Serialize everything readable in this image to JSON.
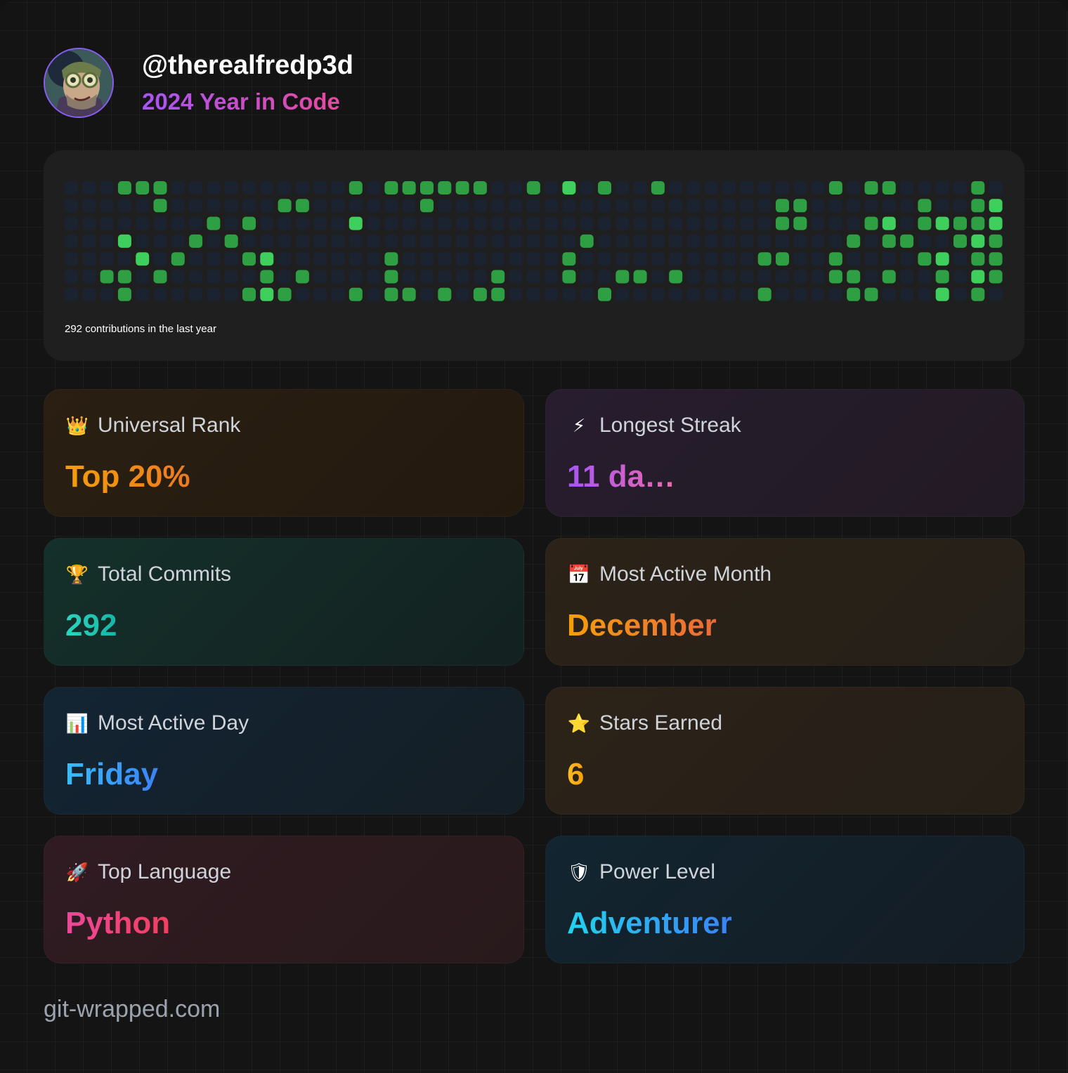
{
  "header": {
    "username": "@therealfredp3d",
    "subtitle": "2024 Year in Code"
  },
  "contributions": {
    "label": "292 contributions in the last year",
    "colors": {
      "empty": "#1b2230",
      "level1": "#2ea043",
      "level2": "#3fcf5c"
    },
    "rows": [
      "0000000000000000000000000000000000000000000000000000000",
      "0000000000000000000000000000000000000000000000000000000",
      "0000000000000000000000000000000000000000000000000000000",
      "0000000000000000000000000000000000000000000000000000000",
      "0000000000000000000000000000000000000000000000000000000",
      "0000000000000000000000000000000000000000000000000000000",
      "0000000000000000000000000000000000000000000000000000000"
    ],
    "active": [
      [
        0,
        3,
        1
      ],
      [
        0,
        4,
        1
      ],
      [
        0,
        5,
        1
      ],
      [
        0,
        16,
        1
      ],
      [
        0,
        18,
        1
      ],
      [
        0,
        19,
        1
      ],
      [
        0,
        20,
        1
      ],
      [
        0,
        21,
        1
      ],
      [
        0,
        22,
        1
      ],
      [
        0,
        23,
        1
      ],
      [
        0,
        26,
        1
      ],
      [
        0,
        28,
        2
      ],
      [
        0,
        30,
        1
      ],
      [
        0,
        33,
        1
      ],
      [
        0,
        43,
        1
      ],
      [
        0,
        45,
        1
      ],
      [
        0,
        46,
        1
      ],
      [
        0,
        51,
        1
      ],
      [
        1,
        5,
        1
      ],
      [
        1,
        12,
        1
      ],
      [
        1,
        13,
        1
      ],
      [
        1,
        20,
        1
      ],
      [
        1,
        40,
        1
      ],
      [
        1,
        41,
        1
      ],
      [
        1,
        48,
        1
      ],
      [
        1,
        51,
        1
      ],
      [
        1,
        52,
        2
      ],
      [
        2,
        8,
        1
      ],
      [
        2,
        10,
        1
      ],
      [
        2,
        16,
        2
      ],
      [
        2,
        40,
        1
      ],
      [
        2,
        41,
        1
      ],
      [
        2,
        45,
        1
      ],
      [
        2,
        46,
        2
      ],
      [
        2,
        48,
        1
      ],
      [
        2,
        49,
        2
      ],
      [
        2,
        50,
        1
      ],
      [
        2,
        51,
        1
      ],
      [
        2,
        52,
        2
      ],
      [
        3,
        3,
        2
      ],
      [
        3,
        7,
        1
      ],
      [
        3,
        9,
        1
      ],
      [
        3,
        29,
        1
      ],
      [
        3,
        44,
        1
      ],
      [
        3,
        46,
        1
      ],
      [
        3,
        47,
        1
      ],
      [
        3,
        50,
        1
      ],
      [
        3,
        51,
        2
      ],
      [
        3,
        52,
        1
      ],
      [
        4,
        4,
        2
      ],
      [
        4,
        6,
        1
      ],
      [
        4,
        10,
        1
      ],
      [
        4,
        11,
        2
      ],
      [
        4,
        18,
        1
      ],
      [
        4,
        28,
        1
      ],
      [
        4,
        39,
        1
      ],
      [
        4,
        40,
        1
      ],
      [
        4,
        43,
        1
      ],
      [
        4,
        48,
        1
      ],
      [
        4,
        49,
        2
      ],
      [
        4,
        51,
        1
      ],
      [
        4,
        52,
        1
      ],
      [
        5,
        2,
        1
      ],
      [
        5,
        3,
        1
      ],
      [
        5,
        5,
        1
      ],
      [
        5,
        11,
        1
      ],
      [
        5,
        13,
        1
      ],
      [
        5,
        18,
        1
      ],
      [
        5,
        24,
        1
      ],
      [
        5,
        28,
        1
      ],
      [
        5,
        31,
        1
      ],
      [
        5,
        32,
        1
      ],
      [
        5,
        34,
        1
      ],
      [
        5,
        43,
        1
      ],
      [
        5,
        44,
        1
      ],
      [
        5,
        46,
        1
      ],
      [
        5,
        49,
        1
      ],
      [
        5,
        51,
        2
      ],
      [
        5,
        52,
        1
      ],
      [
        6,
        3,
        1
      ],
      [
        6,
        10,
        1
      ],
      [
        6,
        11,
        2
      ],
      [
        6,
        12,
        1
      ],
      [
        6,
        16,
        1
      ],
      [
        6,
        18,
        1
      ],
      [
        6,
        19,
        1
      ],
      [
        6,
        21,
        1
      ],
      [
        6,
        23,
        1
      ],
      [
        6,
        24,
        1
      ],
      [
        6,
        30,
        1
      ],
      [
        6,
        39,
        1
      ],
      [
        6,
        44,
        1
      ],
      [
        6,
        45,
        1
      ],
      [
        6,
        49,
        2
      ],
      [
        6,
        51,
        1
      ]
    ]
  },
  "cards": [
    {
      "icon": "crown-icon",
      "glyph": "👑",
      "label": "Universal Rank",
      "value": "Top 20%"
    },
    {
      "icon": "lightning-icon",
      "glyph": "⚡",
      "label": "Longest Streak",
      "value": "11 da…"
    },
    {
      "icon": "trophy-icon",
      "glyph": "🏆",
      "label": "Total Commits",
      "value": "292"
    },
    {
      "icon": "calendar-icon",
      "glyph": "📅",
      "label": "Most Active Month",
      "value": "December"
    },
    {
      "icon": "bar-chart-icon",
      "glyph": "📊",
      "label": "Most Active Day",
      "value": "Friday"
    },
    {
      "icon": "star-icon",
      "glyph": "⭐",
      "label": "Stars Earned",
      "value": "6"
    },
    {
      "icon": "rocket-icon",
      "glyph": "🚀",
      "label": "Top Language",
      "value": "Python"
    },
    {
      "icon": "shield-icon",
      "glyph": "🛡",
      "label": "Power Level",
      "value": "Adventurer"
    }
  ],
  "footer": {
    "text": "git-wrapped.com"
  }
}
